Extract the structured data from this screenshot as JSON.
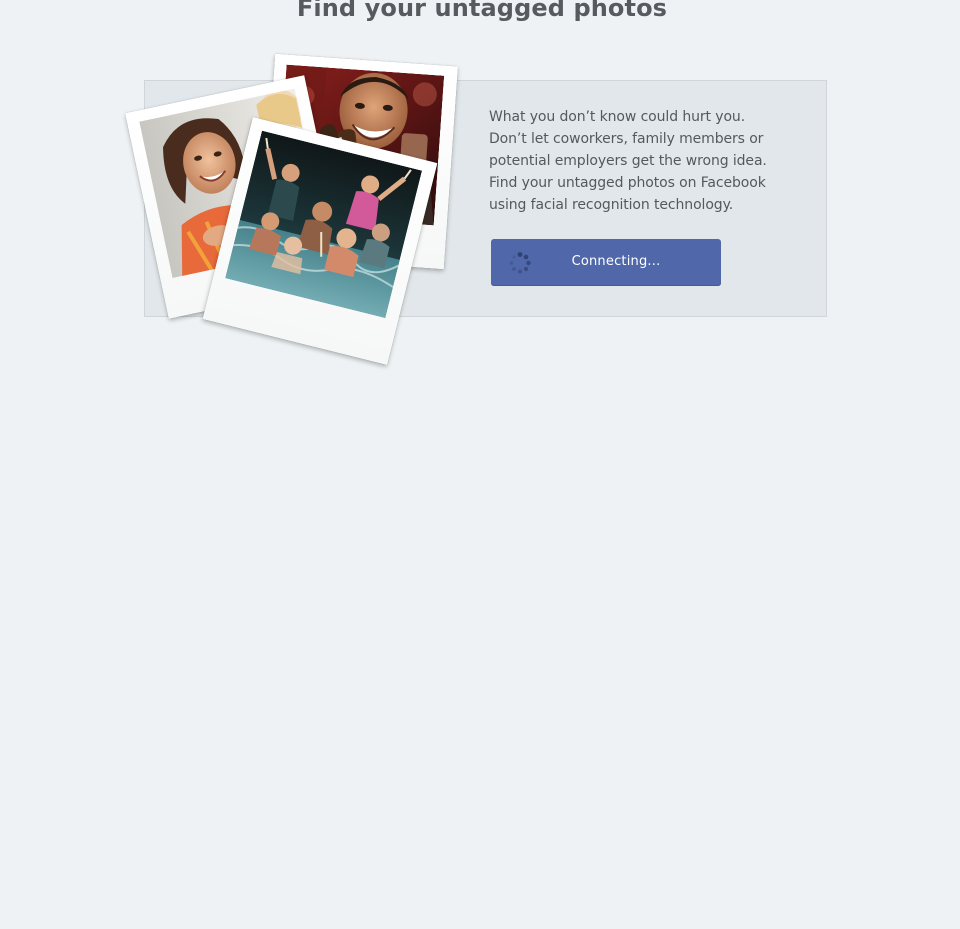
{
  "page": {
    "title": "Find your untagged photos"
  },
  "hero": {
    "description_lines": [
      "What you don’t know could hurt you.",
      "Don’t let coworkers, family members or",
      "potential employers get the wrong idea.",
      "Find your untagged photos on Facebook",
      "using facial recognition technology."
    ],
    "button": {
      "label": "Connecting...",
      "status_icon": "loading-spinner-icon"
    },
    "photos": [
      {
        "subject": "man-with-bottles-photo"
      },
      {
        "subject": "woman-with-wine-photo"
      },
      {
        "subject": "pool-party-photo"
      }
    ]
  },
  "colors": {
    "background": "#eef2f4",
    "panel": "#e1e7ea",
    "button": "#5068aa",
    "title_text": "#575b5f",
    "body_text": "#54595d"
  }
}
